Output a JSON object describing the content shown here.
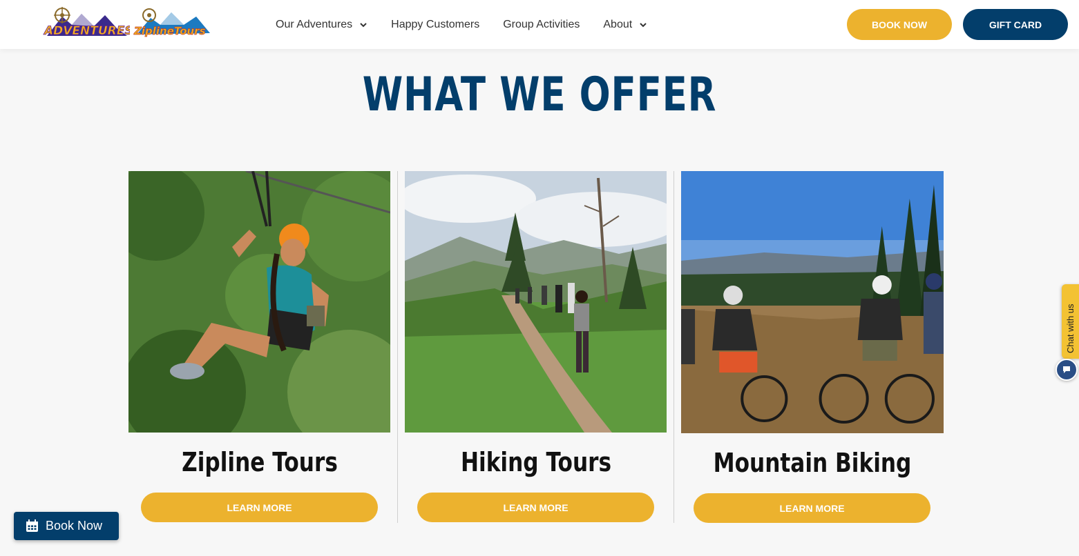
{
  "header": {
    "logos": [
      {
        "name": "denver-adventures-logo",
        "text": "ADVENTURES"
      },
      {
        "name": "denver-zipline-tours-logo",
        "text": "ZiplineTours"
      }
    ],
    "nav": [
      {
        "label": "Our Adventures",
        "has_dropdown": true
      },
      {
        "label": "Happy Customers",
        "has_dropdown": false
      },
      {
        "label": "Group Activities",
        "has_dropdown": false
      },
      {
        "label": "About",
        "has_dropdown": true
      }
    ],
    "book_now_label": "BOOK NOW",
    "gift_card_label": "GIFT CARD"
  },
  "section": {
    "title": "WHAT WE OFFER"
  },
  "cards": [
    {
      "title": "Zipline Tours",
      "button": "LEARN MORE",
      "image": "zipline-rider-photo"
    },
    {
      "title": "Hiking Tours",
      "button": "LEARN MORE",
      "image": "hikers-on-trail-photo"
    },
    {
      "title": "Mountain Biking",
      "button": "LEARN MORE",
      "image": "mountain-bikers-photo"
    }
  ],
  "chat": {
    "label": "Chat with us",
    "icon": "chat-bubble-icon"
  },
  "floating_book": {
    "label": "Book Now",
    "icon": "calendar-icon"
  },
  "colors": {
    "brand_navy": "#033e6b",
    "brand_gold": "#ecb22e",
    "background": "#f7f7f7"
  }
}
